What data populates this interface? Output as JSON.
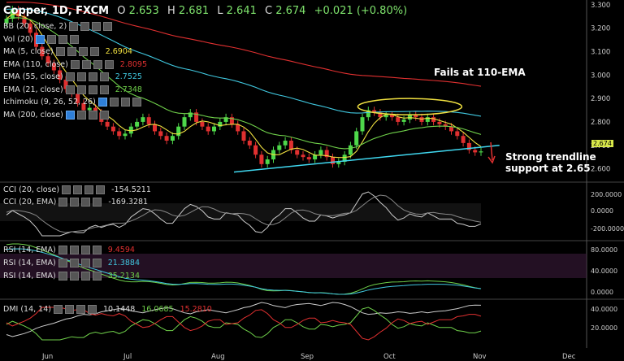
{
  "header": {
    "symbol": "Copper, 1D, FXCM",
    "open_label": "O",
    "open": "2.653",
    "high_label": "H",
    "high": "2.681",
    "low_label": "L",
    "low": "2.641",
    "close_label": "C",
    "close": "2.674",
    "change": "+0.021 (+0.80%)"
  },
  "indicators": [
    {
      "label": "BB (20, close, 2)",
      "value": "",
      "color": "#dddddd"
    },
    {
      "label": "Vol (20)",
      "value": "",
      "color": "#dddddd"
    },
    {
      "label": "MA (5, close)",
      "value": "2.6904",
      "color": "#f0e040"
    },
    {
      "label": "EMA (110, close)",
      "value": "2.8095",
      "color": "#e03030"
    },
    {
      "label": "EMA (55, close)",
      "value": "2.7525",
      "color": "#40c8e0"
    },
    {
      "label": "EMA (21, close)",
      "value": "2.7348",
      "color": "#6fd04a"
    },
    {
      "label": "Ichimoku (9, 26, 52, 26)",
      "value": "",
      "color": "#dddddd"
    },
    {
      "label": "MA (200, close)",
      "value": "",
      "color": "#dddddd"
    }
  ],
  "annotations": {
    "fails": "Fails at 110-EMA",
    "trend_line1": "Strong trendline",
    "trend_line2": "support at 2.65"
  },
  "current_price_tag": "2.674",
  "cci_panel": {
    "rows": [
      {
        "label": "CCI (20, close)",
        "value": "-154.5211",
        "color": "#dddddd"
      },
      {
        "label": "CCI (20, EMA)",
        "value": "-169.3281",
        "color": "#dddddd"
      }
    ],
    "axis": [
      "200.0000",
      "0.0000",
      "-200.0000"
    ]
  },
  "rsi_panel": {
    "rows": [
      {
        "label": "RSI (14, EMA)",
        "value": "9.4594",
        "color": "#e03030"
      },
      {
        "label": "RSI (14, EMA)",
        "value": "21.3884",
        "color": "#40c8e0"
      },
      {
        "label": "RSI (14, EMA)",
        "value": "35.2134",
        "color": "#6fd04a"
      }
    ],
    "axis": [
      "80.0000",
      "40.0000",
      "0.0000"
    ]
  },
  "dmi_panel": {
    "label": "DMI (14, 14)",
    "values": [
      {
        "v": "10.1448",
        "color": "#dddddd"
      },
      {
        "v": "16.0685",
        "color": "#6fd04a"
      },
      {
        "v": "15.2810",
        "color": "#e03030"
      }
    ],
    "axis": [
      "40.0000",
      "20.0000"
    ]
  },
  "chart_data": {
    "type": "candlestick",
    "price_axis": [
      "3.300",
      "3.200",
      "3.100",
      "3.000",
      "2.900",
      "2.800",
      "2.700",
      "2.600"
    ],
    "ylim": [
      2.55,
      3.32
    ],
    "x_ticks": [
      "Jun",
      "Jul",
      "Aug",
      "Sep",
      "Oct",
      "Nov",
      "Dec"
    ],
    "closes": [
      3.24,
      3.28,
      3.25,
      3.22,
      3.18,
      3.12,
      3.08,
      3.05,
      3.02,
      2.98,
      2.94,
      2.92,
      2.88,
      2.85,
      2.86,
      2.84,
      2.8,
      2.78,
      2.76,
      2.74,
      2.75,
      2.78,
      2.8,
      2.82,
      2.79,
      2.76,
      2.74,
      2.72,
      2.74,
      2.78,
      2.82,
      2.84,
      2.8,
      2.78,
      2.76,
      2.78,
      2.8,
      2.82,
      2.79,
      2.76,
      2.72,
      2.7,
      2.66,
      2.62,
      2.64,
      2.68,
      2.7,
      2.72,
      2.68,
      2.66,
      2.65,
      2.64,
      2.66,
      2.68,
      2.65,
      2.62,
      2.63,
      2.66,
      2.7,
      2.76,
      2.82,
      2.85,
      2.84,
      2.82,
      2.83,
      2.82,
      2.8,
      2.81,
      2.83,
      2.82,
      2.8,
      2.82,
      2.8,
      2.79,
      2.78,
      2.76,
      2.74,
      2.71,
      2.68,
      2.67,
      2.674
    ]
  }
}
